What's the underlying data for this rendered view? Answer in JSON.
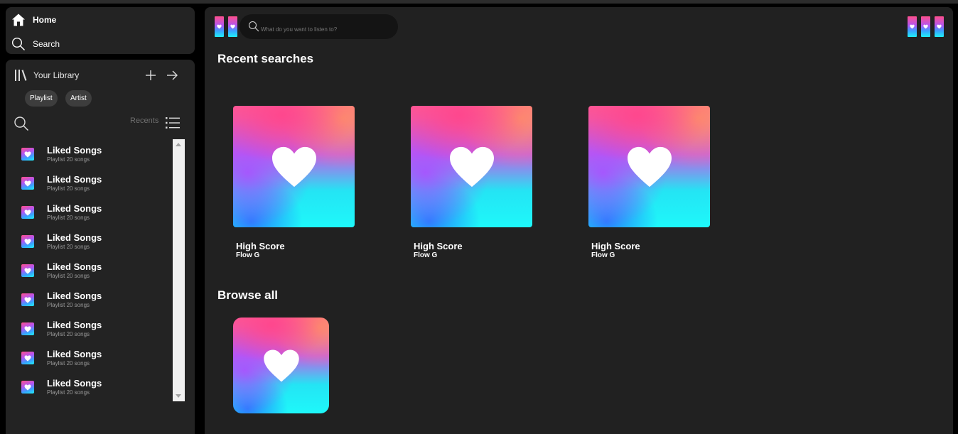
{
  "nav": {
    "home_label": "Home",
    "search_label": "Search"
  },
  "library": {
    "title": "Your Library",
    "chips": [
      "Playlist",
      "Artist"
    ],
    "sort_label": "Recents",
    "items": [
      {
        "title": "Liked Songs",
        "subtitle": "Playlist 20 songs"
      },
      {
        "title": "Liked Songs",
        "subtitle": "Playlist 20 songs"
      },
      {
        "title": "Liked Songs",
        "subtitle": "Playlist 20 songs"
      },
      {
        "title": "Liked Songs",
        "subtitle": "Playlist 20 songs"
      },
      {
        "title": "Liked Songs",
        "subtitle": "Playlist 20 songs"
      },
      {
        "title": "Liked Songs",
        "subtitle": "Playlist 20 songs"
      },
      {
        "title": "Liked Songs",
        "subtitle": "Playlist 20 songs"
      },
      {
        "title": "Liked Songs",
        "subtitle": "Playlist 20 songs"
      },
      {
        "title": "Liked Songs",
        "subtitle": "Playlist 20 songs"
      }
    ]
  },
  "main": {
    "search_placeholder": "What do you want to listen to?",
    "recent_title": "Recent searches",
    "recent": [
      {
        "title": "High Score",
        "artist": "Flow G"
      },
      {
        "title": "High Score",
        "artist": "Flow G"
      },
      {
        "title": "High Score",
        "artist": "Flow G"
      }
    ],
    "browse_title": "Browse all"
  },
  "icons": {
    "home": "home-icon",
    "search": "search-icon",
    "library": "library-icon",
    "plus": "plus-icon",
    "arrow": "arrow-right-icon",
    "list": "list-icon",
    "heart": "heart-icon"
  },
  "colors": {
    "panel": "#232323",
    "main_bg": "#212121",
    "chip": "#3d3d3d",
    "gradient_pink": "#ff4f8b",
    "gradient_purple": "#b056f5",
    "gradient_cyan": "#1ef0f8"
  }
}
